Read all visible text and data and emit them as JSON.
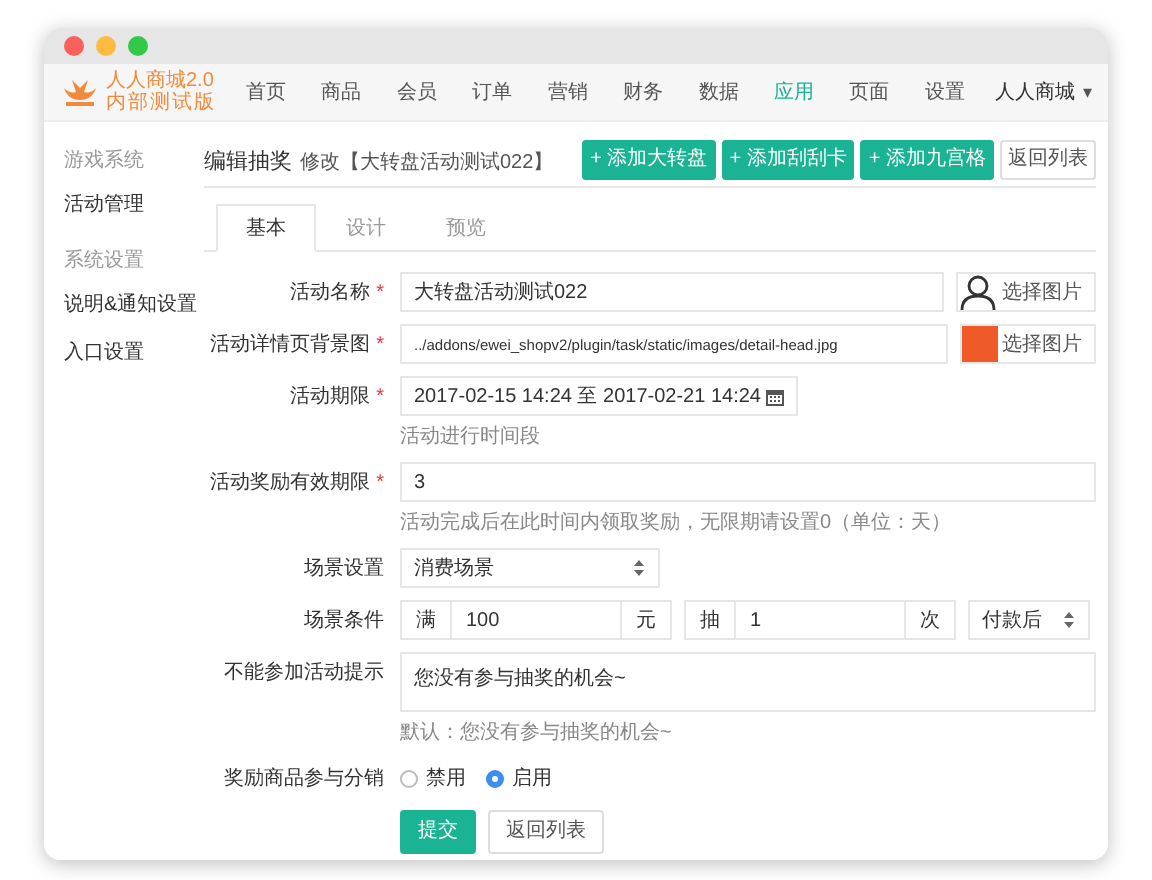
{
  "brand": {
    "name": "人人商城2.0",
    "subtitle": "内部测试版"
  },
  "nav": [
    {
      "label": "首页",
      "selected": false
    },
    {
      "label": "商品",
      "selected": false
    },
    {
      "label": "会员",
      "selected": false
    },
    {
      "label": "订单",
      "selected": false
    },
    {
      "label": "营销",
      "selected": false
    },
    {
      "label": "财务",
      "selected": false
    },
    {
      "label": "数据",
      "selected": false
    },
    {
      "label": "应用",
      "selected": true
    },
    {
      "label": "页面",
      "selected": false
    },
    {
      "label": "设置",
      "selected": false
    }
  ],
  "user_menu": {
    "label": "人人商城",
    "caret": "▾"
  },
  "sidebar": {
    "sections": [
      {
        "heading": "游戏系统",
        "items": [
          "活动管理"
        ]
      },
      {
        "heading": "系统设置",
        "items": [
          "说明&通知设置",
          "入口设置"
        ]
      }
    ]
  },
  "page": {
    "title": "编辑抽奖",
    "subtitle": "修改【大转盘活动测试022】",
    "actions": [
      {
        "label": "+ 添加大转盘",
        "kind": "primary"
      },
      {
        "label": "+ 添加刮刮卡",
        "kind": "primary"
      },
      {
        "label": "+ 添加九宫格",
        "kind": "primary"
      },
      {
        "label": "返回列表",
        "kind": "default"
      }
    ]
  },
  "tabs": [
    {
      "label": "基本",
      "selected": true
    },
    {
      "label": "设计",
      "selected": false
    },
    {
      "label": "预览",
      "selected": false
    }
  ],
  "form": {
    "fields": [
      {
        "kind": "image",
        "label": "活动名称",
        "mark": "*",
        "value": "大转盘活动测试022",
        "picker": {
          "label": "选择图片",
          "kind": "avatar"
        }
      },
      {
        "kind": "image",
        "label": "活动详情页背景图",
        "mark": "*",
        "value": "../addons/ewei_shopv2/plugin/task/static/images/detail-head.jpg",
        "picker": {
          "label": "选择图片",
          "kind": "photo"
        }
      },
      {
        "kind": "date",
        "label": "活动期限",
        "mark": "*",
        "value": "2017-02-15 14:24 至 2017-02-21 14:24",
        "help": "活动进行时间段"
      },
      {
        "kind": "text",
        "label": "活动奖励有效期限",
        "mark": "*",
        "value": "3",
        "help": "活动完成后在此时间内领取奖励，无限期请设置0（单位：天）"
      },
      {
        "kind": "select",
        "label": "场景设置",
        "value": "消费场景"
      },
      {
        "kind": "condition",
        "label": "场景条件",
        "groups": [
          {
            "prefix": "满",
            "value": "100",
            "suffix": "元"
          },
          {
            "prefix": "抽",
            "value": "1",
            "suffix": "次"
          }
        ],
        "select": "付款后"
      },
      {
        "kind": "textarea",
        "label": "不能参加活动提示",
        "value": "您没有参与抽奖的机会~",
        "help": "默认：您没有参与抽奖的机会~"
      },
      {
        "kind": "radio",
        "label": "奖励商品参与分销",
        "options": [
          {
            "label": "禁用",
            "selected": false
          },
          {
            "label": "启用",
            "selected": true
          }
        ]
      }
    ],
    "buttons": [
      {
        "label": "提交",
        "kind": "primary"
      },
      {
        "label": "返回列表",
        "kind": "default"
      }
    ]
  }
}
